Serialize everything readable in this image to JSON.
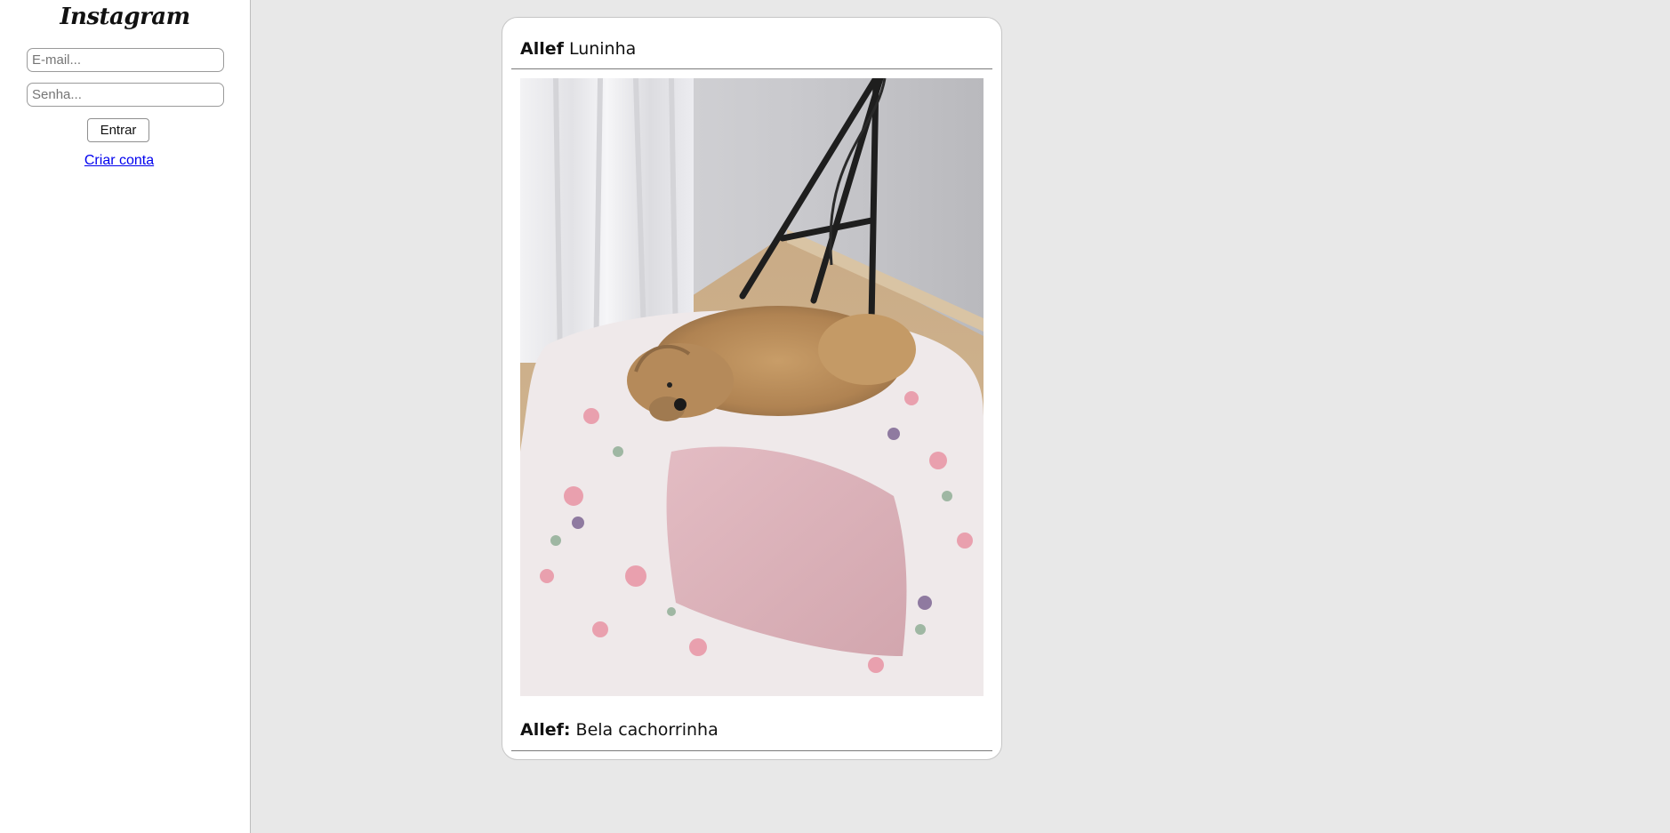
{
  "sidebar": {
    "logo": "Instagram",
    "email_placeholder": "E-mail...",
    "senha_placeholder": "Senha...",
    "entrar_label": "Entrar",
    "criar_conta_label": "Criar conta"
  },
  "post": {
    "author": "Allef",
    "title": "Luninha",
    "image_icon": "photo-dog-on-bed",
    "comment_author": "Allef:",
    "comment_text": "Bela cachorrinha"
  },
  "colors": {
    "page_background": "#e8e8e8",
    "link": "#0000ee"
  }
}
